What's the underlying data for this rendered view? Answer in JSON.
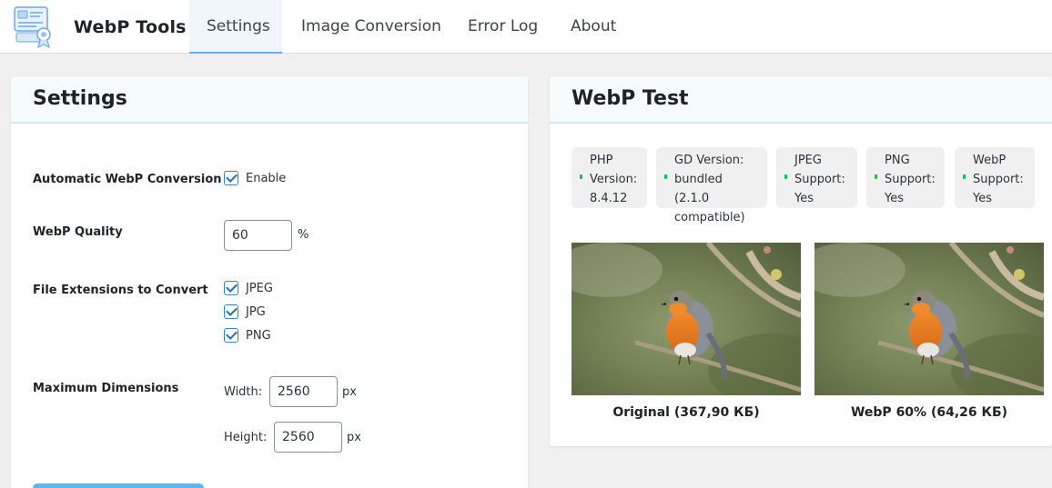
{
  "app": {
    "brand": "WebP Tools"
  },
  "nav": {
    "tabs": [
      {
        "label": "Settings",
        "active": true
      },
      {
        "label": "Image Conversion",
        "active": false
      },
      {
        "label": "Error Log",
        "active": false
      },
      {
        "label": "About",
        "active": false
      }
    ]
  },
  "settings": {
    "title": "Settings",
    "auto_conversion": {
      "label": "Automatic WebP Conversion",
      "option": "Enable",
      "checked": true
    },
    "quality": {
      "label": "WebP Quality",
      "value": "60",
      "unit": "%"
    },
    "extensions": {
      "label": "File Extensions to Convert",
      "items": [
        {
          "label": "JPEG",
          "checked": true
        },
        {
          "label": "JPG",
          "checked": true
        },
        {
          "label": "PNG",
          "checked": true
        }
      ]
    },
    "dimensions": {
      "label": "Maximum Dimensions",
      "width_label": "Width:",
      "width_value": "2560",
      "width_unit": "px",
      "height_label": "Height:",
      "height_value": "2560",
      "height_unit": "px"
    }
  },
  "webp_test": {
    "title": "WebP Test",
    "chips": [
      {
        "lines": [
          "PHP",
          "Version:",
          "8.4.12"
        ]
      },
      {
        "lines": [
          "GD Version:",
          "bundled (2.1.0",
          "compatible)"
        ]
      },
      {
        "lines": [
          "JPEG",
          "Support:",
          "Yes"
        ]
      },
      {
        "lines": [
          "PNG",
          "Support:",
          "Yes"
        ]
      },
      {
        "lines": [
          "WebP",
          "Support:",
          "Yes"
        ]
      }
    ],
    "original_caption": "Original (367,90 КБ)",
    "webp_caption": "WebP 60% (64,26 КБ)"
  },
  "colors": {
    "accent": "#2271b1",
    "status_dot": "#00c853",
    "button": "#5bb8ec"
  }
}
